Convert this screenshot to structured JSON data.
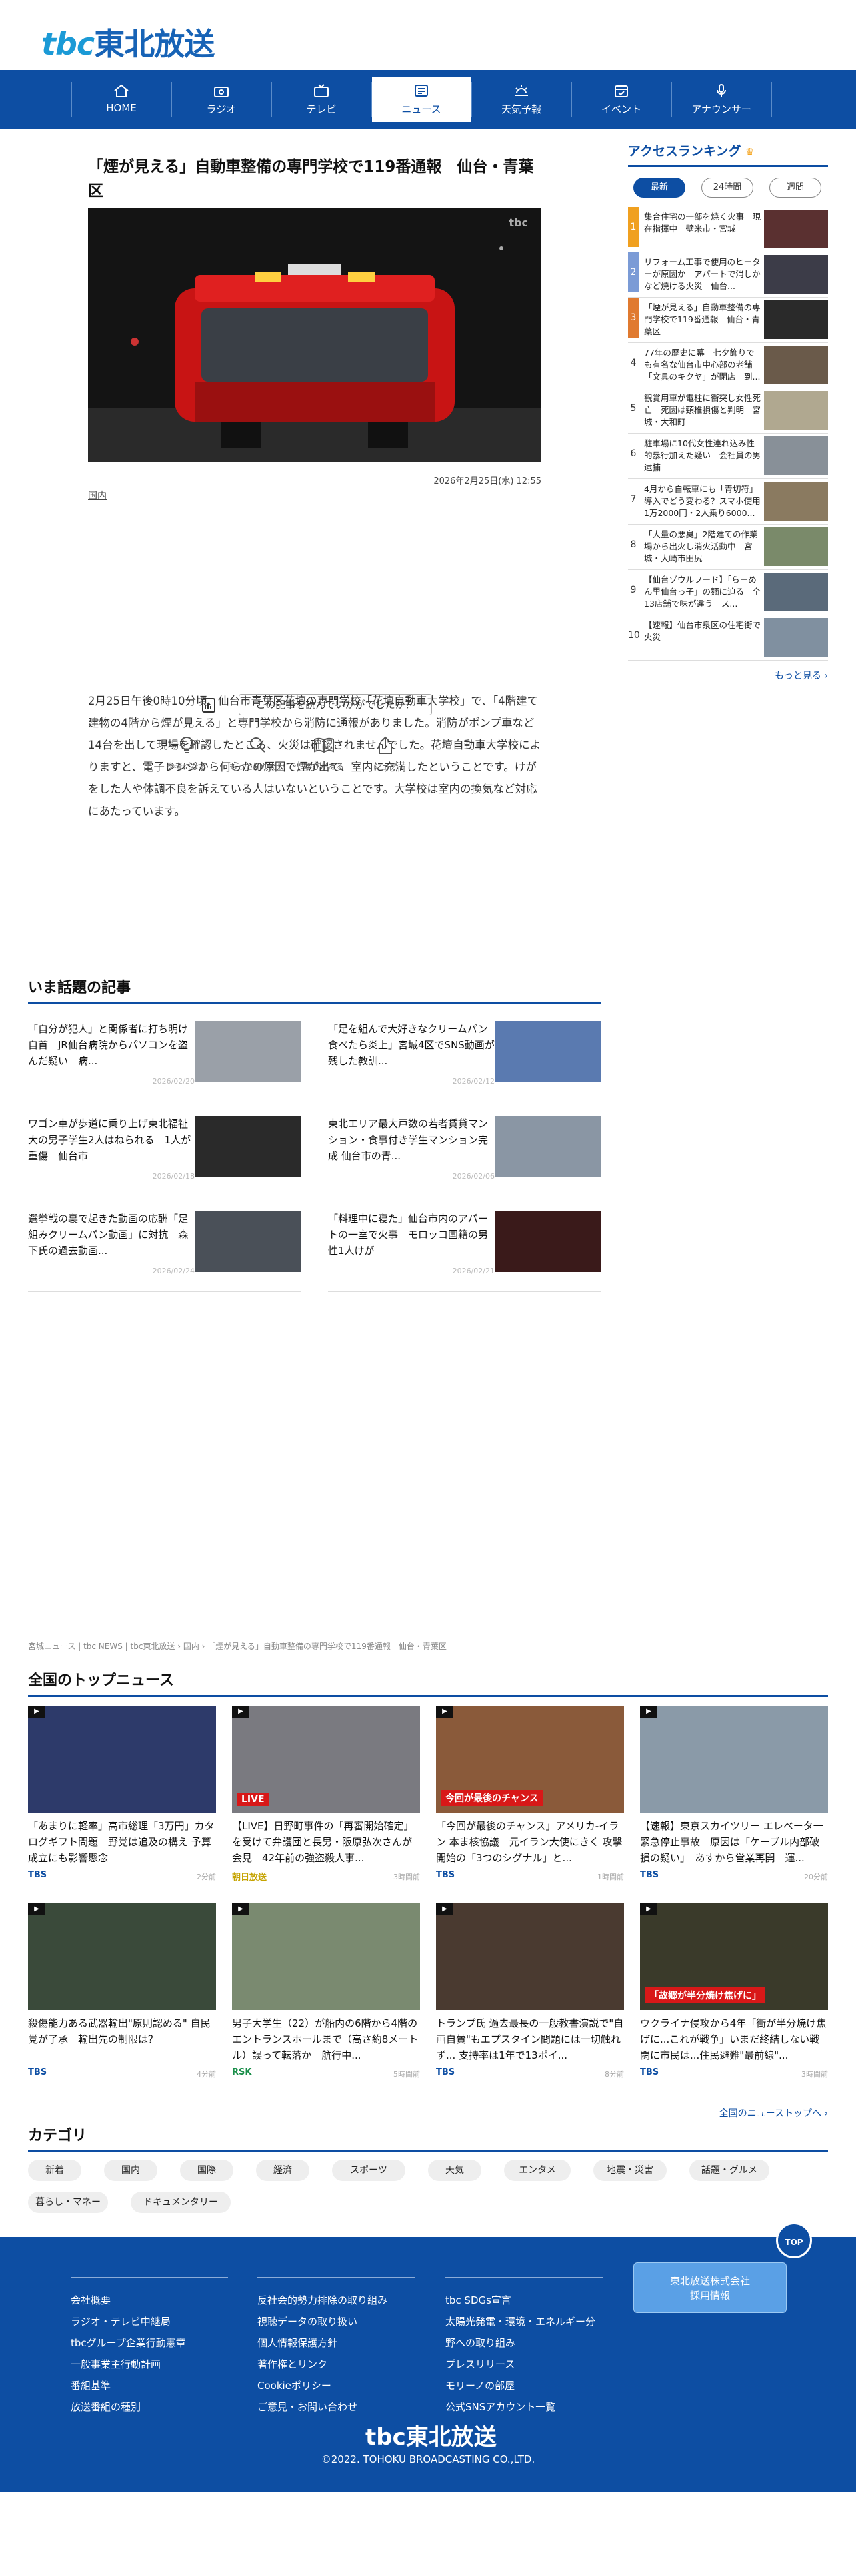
{
  "brand": {
    "logo_latin": "tbc",
    "logo_jp": "東北放送",
    "accent": "#0d4ea3"
  },
  "nav": [
    {
      "label": "HOME",
      "icon": "home-icon"
    },
    {
      "label": "ラジオ",
      "icon": "radio-icon"
    },
    {
      "label": "テレビ",
      "icon": "tv-icon"
    },
    {
      "label": "ニュース",
      "icon": "news-icon",
      "active": true
    },
    {
      "label": "天気予報",
      "icon": "weather-icon"
    },
    {
      "label": "イベント",
      "icon": "event-icon"
    },
    {
      "label": "アナウンサー",
      "icon": "microphone-icon"
    }
  ],
  "article": {
    "title": "「煙が見える」自動車整備の専門学校で119番通報　仙台・青葉区",
    "date": "2026年2月25日(水) 12:55",
    "category": "国内",
    "photo_watermark": "tbc",
    "body": "2月25日午後0時10分頃、仙台市青葉区花壇の専門学校「花壇自動車大学校」で、「4階建て建物の4階から煙が見える」と専門学校から消防に通報がありました。消防がポンプ車など14台を出して現場を確認したところ、火災は確認されませんでした。花壇自動車大学校によりますと、電子レンジから何らかの原因で煙が出て、室内に充満したということです。けがをした人や体調不良を訴えている人はいないということです。大学校は室内の換気など対応にあたっています。"
  },
  "feedback": {
    "question": "この記事を読んでいかがでしたか？",
    "buttons": [
      "参考になる",
      "もっと知りたい",
      "学びがある",
      "シェア"
    ]
  },
  "ranking": {
    "title": "アクセスランキング",
    "tabs": [
      "最新",
      "24時間",
      "週間"
    ],
    "items": [
      {
        "rank": "1",
        "text": "集合住宅の一部を焼く火事　現在指揮中　壁米市・宮城"
      },
      {
        "rank": "2",
        "text": "リフォーム工事で使用のヒーターが原因か　アパートで消しかなど焼ける火災　仙台..."
      },
      {
        "rank": "3",
        "text": "「煙が見える」自動車整備の専門学校で119番通報　仙台・青葉区"
      },
      {
        "rank": "4",
        "text": "77年の歴史に幕　七夕飾りでも有名な仙台市中心部の老舗「文具のキクヤ」が閉店　到..."
      },
      {
        "rank": "5",
        "text": "観賞用車が電柱に衝突し女性死亡　死因は頸椎損傷と判明　宮城・大和町"
      },
      {
        "rank": "6",
        "text": "駐車場に10代女性連れ込み性的暴行加えた疑い　会社員の男逮捕"
      },
      {
        "rank": "7",
        "text": "4月から自転車にも「青切符」導入でどう変わる？スマホ使用1万2000円・2人乗り6000..."
      },
      {
        "rank": "8",
        "text": "「大量の悪臭」2階建ての作業場から出火し消火活動中　宮城・大崎市田尻"
      },
      {
        "rank": "9",
        "text": "【仙台ゾウルフード】「らーめん里仙台っ子」の麺に迫る　全13店舗で味が違う　ス..."
      },
      {
        "rank": "10",
        "text": "【速報】仙台市泉区の住宅街で火災"
      }
    ],
    "more": "もっと見る ›"
  },
  "topics": {
    "title": "いま話題の記事",
    "items": [
      {
        "text": "「自分が犯人」と関係者に打ち明け自首　JR仙台病院からパソコンを盗んだ疑い　病...",
        "date": "2026/02/20"
      },
      {
        "text": "「足を組んで大好きなクリームパン食べたら炎上」宮城4区でSNS動画が残した教訓...",
        "date": "2026/02/12"
      },
      {
        "text": "ワゴン車が歩道に乗り上げ東北福祉大の男子学生2人はねられる　1人が重傷　仙台市",
        "date": "2026/02/18"
      },
      {
        "text": "東北エリア最大戸数の若者賃貸マンション・食事付き学生マンション完成 仙台市の青...",
        "date": "2026/02/06"
      },
      {
        "text": "選挙戦の裏で起きた動画の応酬「足組みクリームパン動画」に対抗　森下氏の過去動画...",
        "date": "2026/02/24"
      },
      {
        "text": "「料理中に寝た」仙台市内のアパートの一室で火事　モロッコ国籍の男性1人けが",
        "date": "2026/02/21"
      }
    ]
  },
  "breadcrumb": "宮城ニュース | tbc NEWS | tbc東北放送 › 国内 › 「煙が見える」自動車整備の専門学校で119番通報　仙台・青葉区",
  "national": {
    "title": "全国のトップニュース",
    "items": [
      {
        "text": "「あまりに軽率」高市総理「3万円」カタログギフト問題　野党は追及の構え 予算成立にも影響懸念",
        "source": "TBS",
        "date": "2分前",
        "color": "#0d4ea3"
      },
      {
        "text": "【LIVE】日野町事件の「再審開始確定」を受けて弁護団と長男・阪原弘次さんが会見　42年前の強盗殺人事...",
        "source": "朝日放送",
        "date": "3時間前",
        "color": "#c5a300"
      },
      {
        "text": "「今回が最後のチャンス」アメリカ-イラン 本ま核協議　元イラン大使にきく 攻撃開始の「3つのシグナル」と...",
        "source": "TBS",
        "date": "1時間前",
        "color": "#0d4ea3"
      },
      {
        "text": "【速報】東京スカイツリー エレベータ一緊急停止事故　原因は「ケーブル内部破損の疑い」　あすから営業再開　運...",
        "source": "TBS",
        "date": "20分前",
        "color": "#0d4ea3"
      },
      {
        "text": "殺傷能力ある武器輸出\"原則認める\" 自民党が了承　輸出先の制限は？",
        "source": "TBS",
        "date": "4分前",
        "color": "#0d4ea3"
      },
      {
        "text": "男子大学生（22）が船内の6階から4階のエントランスホールまで（高さ約8メートル）誤って転落か　航行中...",
        "source": "RSK",
        "date": "5時間前",
        "color": "#1a8f4a"
      },
      {
        "text": "トランプ氏 過去最長の一般教書演説で\"自画自賛\"もエプスタイン問題には一切触れず... 支持率は1年で13ポイ...",
        "source": "TBS",
        "date": "8分前",
        "color": "#0d4ea3"
      },
      {
        "text": "ウクライナ侵攻から4年「街が半分焼け焦げに...これが戦争」いまだ終結しない戦闘に市民は...住民避難\"最前線\"...",
        "source": "TBS",
        "date": "3時間前",
        "color": "#0d4ea3"
      }
    ],
    "thumb_captions": [
      "",
      "LIVE",
      "今回が最後のチャンス",
      "",
      "",
      "",
      "",
      "「故郷が半分焼け焦げに」"
    ],
    "more": "全国のニューストップへ ›"
  },
  "category": {
    "title": "カテゴリ",
    "chips": [
      "新着",
      "国内",
      "国際",
      "経済",
      "スポーツ",
      "天気",
      "エンタメ",
      "地震・災害",
      "話題・グルメ",
      "暮らし・マネー",
      "ドキュメンタリー"
    ]
  },
  "footer": {
    "col1": [
      "会社概要",
      "ラジオ・テレビ中継局",
      "tbcグループ企業行動憲章",
      "一般事業主行動計画",
      "番組基準",
      "放送番組の種別"
    ],
    "col2": [
      "反社会的勢力排除の取り組み",
      "視聴データの取り扱い",
      "個人情報保護方針",
      "著作権とリンク",
      "Cookieポリシー",
      "ご意見・お問い合わせ"
    ],
    "col3": [
      "tbc SDGs宣言",
      "太陽光発電・環境・エネルギー分野への取り組み",
      "プレスリリース",
      "モリーノの部屋",
      "公式SNSアカウント一覧"
    ],
    "recruit": "東北放送株式会社\n採用情報",
    "logo": "tbc東北放送",
    "copyright": "©2022. TOHOKU BROADCASTING CO.,LTD.",
    "totop": "TOP"
  }
}
